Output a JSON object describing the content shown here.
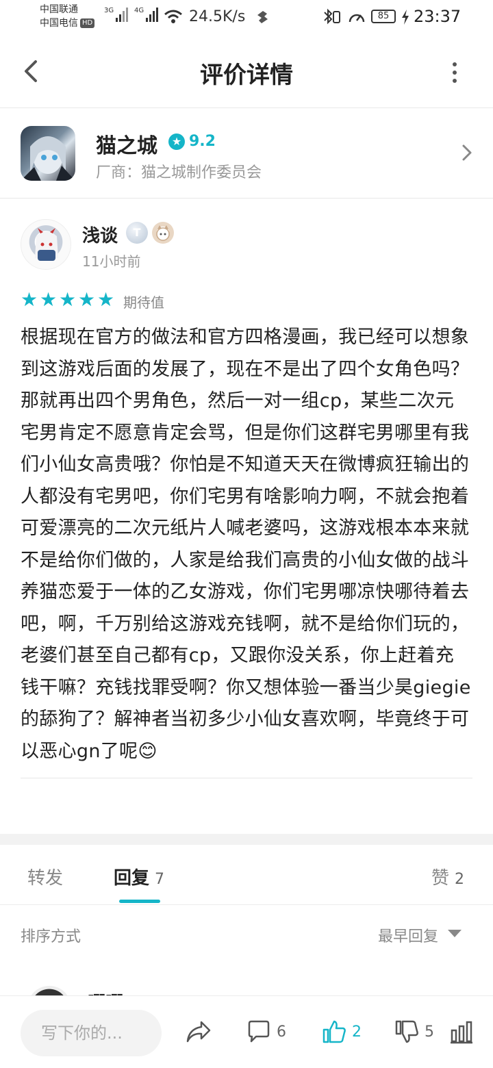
{
  "status_bar": {
    "carrier1": "中国联通",
    "carrier2": "中国电信",
    "hd": "HD",
    "net1": "3G",
    "net2": "4G",
    "speed": "24.5K/s",
    "battery": "85",
    "time": "23:37"
  },
  "header": {
    "title": "评价详情",
    "back_icon": "chevron-left-icon",
    "more_icon": "more-vertical-icon"
  },
  "game": {
    "name": "猫之城",
    "score": "9.2",
    "vendor": "厂商：猫之城制作委员会"
  },
  "review": {
    "username": "浅谈",
    "badge_letter": "T",
    "time": "11小时前",
    "stars": 5,
    "stars_label": "期待值",
    "text": "根据现在官方的做法和官方四格漫画，我已经可以想象到这游戏后面的发展了，现在不是出了四个女角色吗？那就再出四个男角色，然后一对一组cp，某些二次元宅男肯定不愿意肯定会骂，但是你们这群宅男哪里有我们小仙女高贵哦？你怕是不知道天天在微博疯狂输出的人都没有宅男吧，你们宅男有啥影响力啊，不就会抱着可爱漂亮的二次元纸片人喊老婆吗，这游戏根本本来就不是给你们做的，人家是给我们高贵的小仙女做的战斗养猫恋爱于一体的乙女游戏，你们宅男哪凉快哪待着去吧，啊，千万别给这游戏充钱啊，就不是给你们玩的，老婆们甚至自己都有cp，又跟你没关系，你上赶着充钱干嘛？充钱找罪受啊？你又想体验一番当少昊giegie的舔狗了？解神者当初多少小仙女喜欢啊，毕竟终于可以恶心gn了呢😊"
  },
  "tabs": {
    "forward": "转发",
    "reply": "回复",
    "reply_count": "7",
    "like": "赞",
    "like_count": "2"
  },
  "sort": {
    "label": "排序方式",
    "value": "最早回复"
  },
  "reply_preview": {
    "name": "唧唧"
  },
  "bottom_bar": {
    "placeholder": "写下你的...",
    "comments": "6",
    "likes": "2",
    "dislikes": "5"
  },
  "colors": {
    "accent": "#15b5c8"
  }
}
